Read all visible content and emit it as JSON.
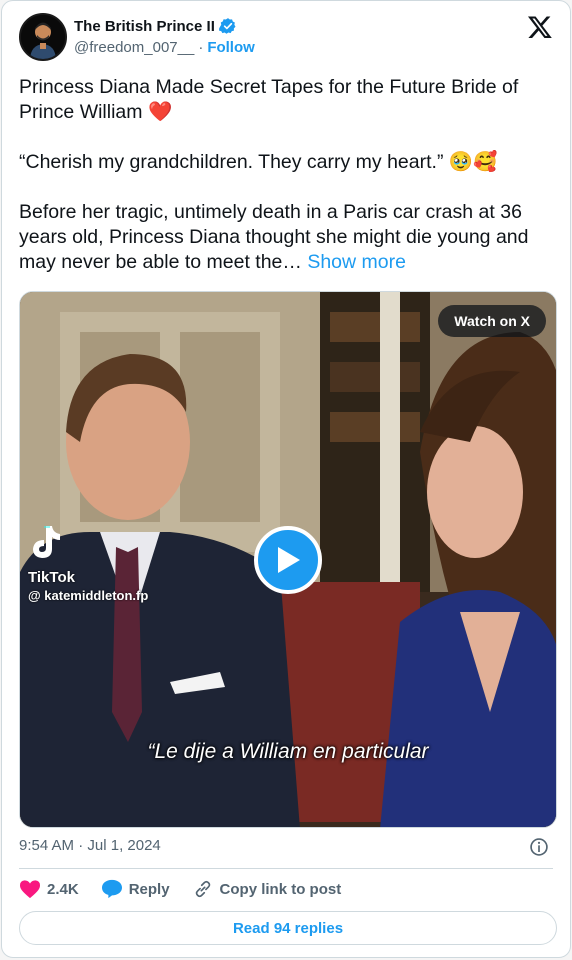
{
  "author": {
    "name": "The British Prince II",
    "handle": "@freedom_007__",
    "separator": "·",
    "follow_label": "Follow",
    "verified": true,
    "avatar_icon": "avatar-cartoon-man"
  },
  "platform_icon": "x-logo-icon",
  "tweet": {
    "line1": "Princess Diana Made Secret Tapes for the Future Bride of Prince William",
    "line1_emoji": "❤️",
    "line2": "“Cherish my grandchildren. They carry my heart.”",
    "line2_emoji": "🥹🥰",
    "line3": "Before her tragic, untimely death in a Paris car crash at 36 years old, Princess Diana thought she might die young and may never be able to meet the…",
    "show_more": "Show more"
  },
  "media": {
    "watch_label": "Watch on X",
    "tiktok_label": "TikTok",
    "tiktok_handle": "@ katemiddleton.fp",
    "caption": "“Le dije a William en particular",
    "play_icon": "play-icon"
  },
  "meta": {
    "time": "9:54 AM",
    "separator": "·",
    "date": "Jul 1, 2024",
    "info_icon": "info-icon"
  },
  "actions": {
    "likes": "2.4K",
    "reply_label": "Reply",
    "copy_label": "Copy link to post",
    "read_replies": "Read 94 replies"
  },
  "colors": {
    "accent": "#1d9bf0",
    "like": "#f91880",
    "text_primary": "#0f1419",
    "text_secondary": "#536471",
    "border": "#cfd9de"
  }
}
